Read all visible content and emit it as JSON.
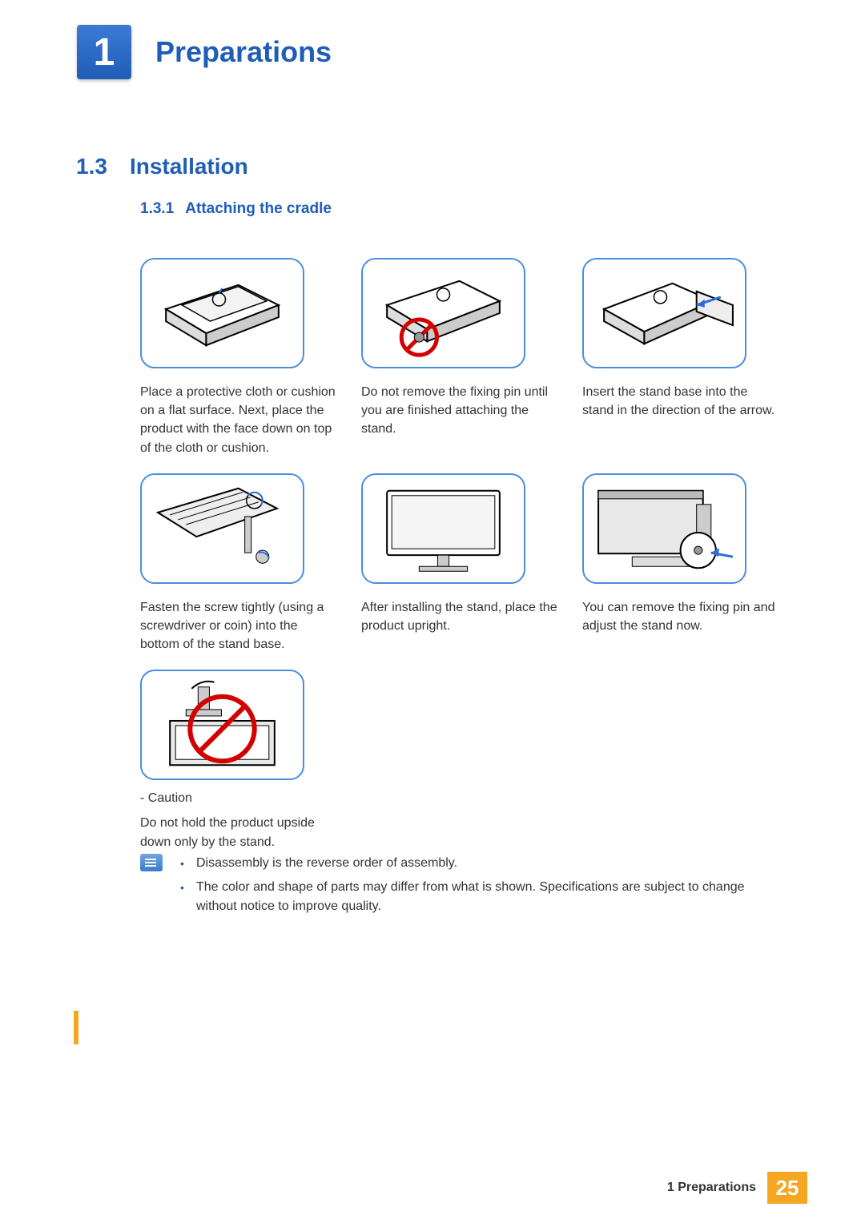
{
  "chapter": {
    "number": "1",
    "title": "Preparations"
  },
  "section": {
    "number": "1.3",
    "title": "Installation"
  },
  "subsection": {
    "number": "1.3.1",
    "title": "Attaching the cradle"
  },
  "steps": [
    {
      "caption": "Place a protective cloth or cushion on a flat surface. Next, place the product with the face down on top of the cloth or cushion."
    },
    {
      "caption": "Do not remove the fixing pin until you are finished attaching the stand."
    },
    {
      "caption": "Insert the stand base into the stand in the direction of the arrow."
    },
    {
      "caption": "Fasten the screw tightly (using a screwdriver or coin) into the bottom of the stand base."
    },
    {
      "caption": "After installing the stand, place the product upright."
    },
    {
      "caption": "You can remove the fixing pin and adjust the stand now."
    }
  ],
  "caution": {
    "label": "- Caution",
    "text": "Do not hold the product upside down only by the stand."
  },
  "notes": [
    "Disassembly is the reverse order of assembly.",
    "The color and shape of parts may differ from what is shown. Specifications are subject to change without notice to improve quality."
  ],
  "footer": {
    "label": "1 Preparations",
    "page": "25"
  }
}
